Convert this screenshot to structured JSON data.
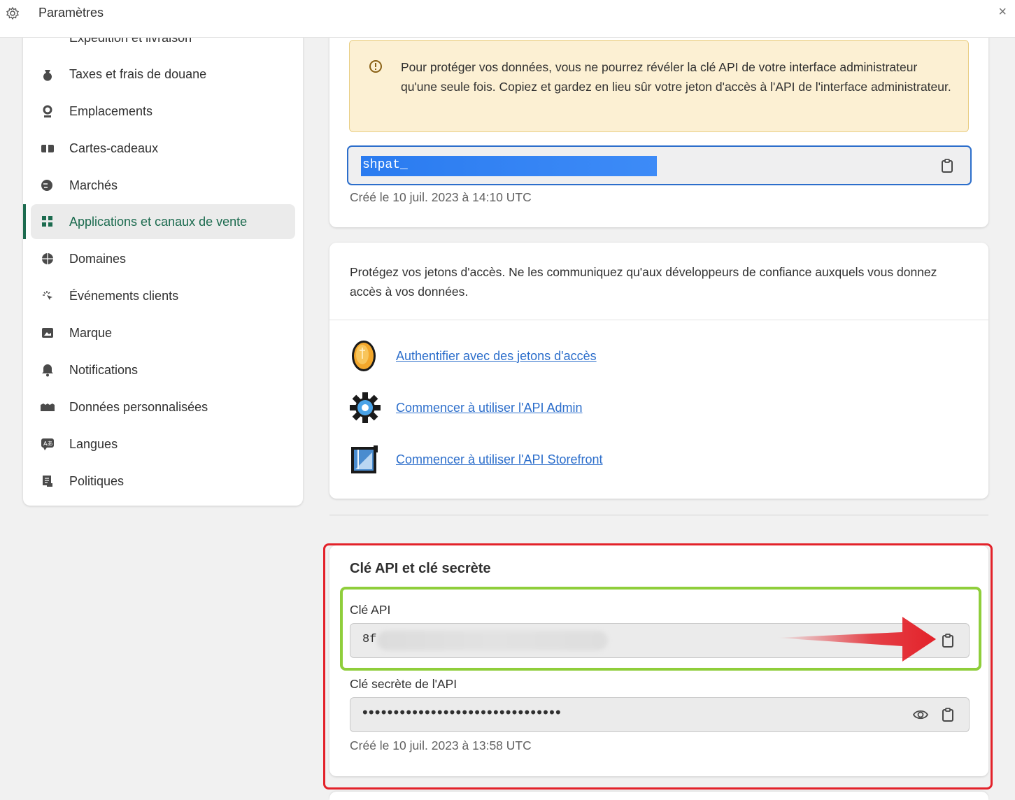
{
  "window": {
    "title": "Paramètres",
    "close_glyph": "×"
  },
  "sidebar": {
    "partial_item": "Expédition et livraison",
    "items": [
      {
        "label": "Taxes et frais de douane",
        "icon": "tax-icon"
      },
      {
        "label": "Emplacements",
        "icon": "location-pin-icon"
      },
      {
        "label": "Cartes-cadeaux",
        "icon": "gift-card-icon"
      },
      {
        "label": "Marchés",
        "icon": "globe-markets-icon"
      },
      {
        "label": "Applications et canaux de vente",
        "icon": "apps-icon",
        "active": true
      },
      {
        "label": "Domaines",
        "icon": "globe-icon"
      },
      {
        "label": "Événements clients",
        "icon": "cursor-click-icon"
      },
      {
        "label": "Marque",
        "icon": "brand-icon"
      },
      {
        "label": "Notifications",
        "icon": "bell-icon"
      },
      {
        "label": "Données personnalisées",
        "icon": "data-icon"
      },
      {
        "label": "Langues",
        "icon": "language-icon"
      },
      {
        "label": "Politiques",
        "icon": "policy-icon"
      }
    ]
  },
  "access_token_card": {
    "warning": "Pour protéger vos données, vous ne pourrez révéler la clé API de votre interface administrateur qu'une seule fois. Copiez et gardez en lieu sûr votre jeton d'accès à l'API de l'interface administrateur.",
    "token_value": "shpat_",
    "created": "Créé le 10 juil. 2023 à 14:10 UTC"
  },
  "resources_card": {
    "intro": "Protégez vos jetons d'accès. Ne les communiquez qu'aux développeurs de confiance auxquels vous donnez accès à vos données.",
    "links": [
      {
        "label": "Authentifier avec des jetons d'accès",
        "icon": "coin-icon"
      },
      {
        "label": "Commencer à utiliser l'API Admin",
        "icon": "gear-cog-icon"
      },
      {
        "label": "Commencer à utiliser l'API Storefront",
        "icon": "blueprint-icon"
      }
    ]
  },
  "api_keys_card": {
    "heading": "Clé API et clé secrète",
    "api_key_label": "Clé API",
    "api_key_value": "8f",
    "secret_label": "Clé secrète de l'API",
    "secret_value": "••••••••••••••••••••••••••••••••",
    "created": "Créé le 10 juil. 2023 à 13:58 UTC"
  },
  "colors": {
    "accent_green": "#1c6b4f",
    "link_blue": "#2c6ecb",
    "annotation_red": "#e3222a",
    "annotation_green": "#8fce3b"
  }
}
